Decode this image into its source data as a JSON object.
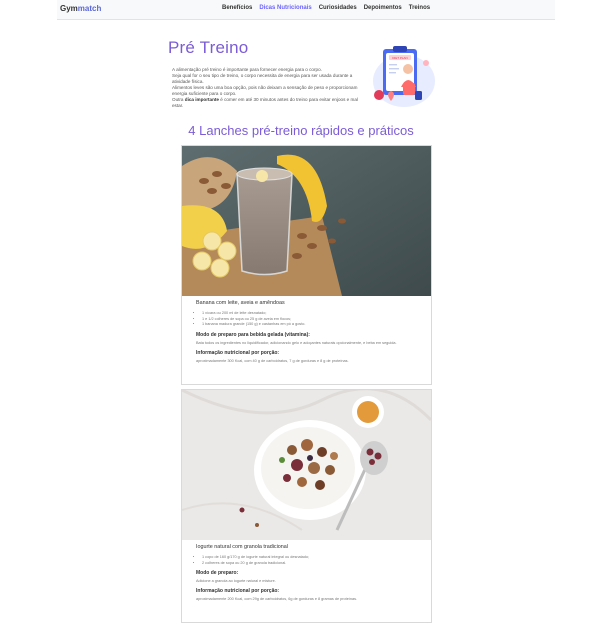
{
  "navbar": {
    "brand_part1": "Gym",
    "brand_part2": "match",
    "links": [
      {
        "label": "Benefícios"
      },
      {
        "label": "Dicas Nutricionais"
      },
      {
        "label": "Curiosidades"
      },
      {
        "label": "Depoimentos"
      },
      {
        "label": "Treinos"
      }
    ]
  },
  "page": {
    "title": "Pré Treino",
    "intro": [
      "A alimentação pré treino é importante para fornecer energia para o corpo.",
      "Seja qual for o seu tipo de treino, o corpo necessita de energia para ser usada durante a atividade física.",
      "Alimentos leves são uma boa opção, pois não deixam a sensação de peso e proporcionam energia suficiente para o corpo."
    ],
    "intro_last_prefix": "Outra ",
    "intro_last_bold": "dica importante",
    "intro_last_suffix": " é comer em até 30 minutos antes do treino para evitar enjoos e mal estar.",
    "illustration_label": "DIET PLAN",
    "section_title": "4 Lanches pré-treino rápidos e práticos"
  },
  "colors": {
    "accent": "#7b5cd6",
    "brand_accent": "#5a67d8"
  },
  "snacks": [
    {
      "name": "Banana com leite, aveia e amêndoas",
      "ingredients": [
        "1 xícara ou 200 ml de leite desnatado;",
        "1 e 1/2 colheres de sopa ou 25 g de aveia em flocos;",
        "1 banana madura grande (150 g) e castanhas em pó a gosto."
      ],
      "prep_title": "Modo de preparo para bebida gelada (vitamina):",
      "prep_text": "Bata todos os ingredientes no liquidificador, adicionando gelo e adoçantes naturais opcionalmente, e beba em seguida.",
      "info_title": "Informação nutricional por porção:",
      "info_text": "aproximadamente 300 Kcal, com 40 g de carboidratos, 7 g de gorduras e 8 g de proteínas."
    },
    {
      "name": "Iogurte natural com granola tradicional",
      "ingredients": [
        "1 copo de 160 g/170 g de iogurte natural integral ou desnatado;",
        "2 colheres de sopa ou 20 g de granola tradicional."
      ],
      "prep_title": "Modo de preparo:",
      "prep_text": "Adicione a granola ao iogurte natural e misture.",
      "info_title": "Informação nutricional por porção:",
      "info_text": "aproximadamente 200 Kcal, com 29g de carboidratos, 6g de gorduras e 8 gramas de proteínas."
    }
  ]
}
